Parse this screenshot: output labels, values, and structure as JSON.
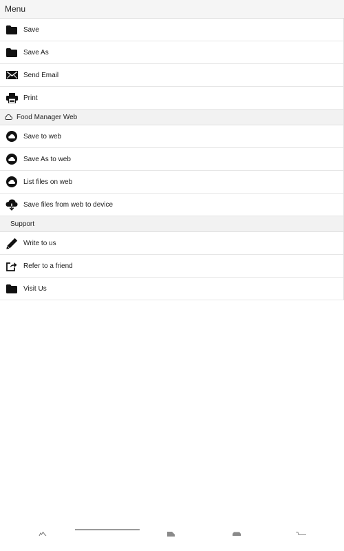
{
  "header": {
    "title": "Menu"
  },
  "main_items": [
    {
      "label": "Save",
      "icon": "folder-icon"
    },
    {
      "label": "Save As",
      "icon": "folder-icon"
    },
    {
      "label": "Send Email",
      "icon": "envelope-icon"
    },
    {
      "label": "Print",
      "icon": "printer-icon"
    }
  ],
  "web_section": {
    "title": "Food Manager Web",
    "icon": "cloud-outline-icon",
    "items": [
      {
        "label": "Save to web",
        "icon": "cloud-circle-icon"
      },
      {
        "label": "Save As to web",
        "icon": "cloud-circle-icon"
      },
      {
        "label": "List files on web",
        "icon": "cloud-circle-icon"
      },
      {
        "label": "Save files from web to device",
        "icon": "cloud-download-icon"
      }
    ]
  },
  "support_section": {
    "title": "Support",
    "items": [
      {
        "label": "Write to us",
        "icon": "pencil-icon"
      },
      {
        "label": "Refer to a friend",
        "icon": "share-icon"
      },
      {
        "label": "Visit Us",
        "icon": "folder-icon"
      }
    ]
  },
  "bottom_tabs": [
    {
      "icon": "tab-home-icon"
    },
    {
      "icon": "tab-document-icon"
    },
    {
      "icon": "tab-shop-icon"
    },
    {
      "icon": "tab-cart-icon"
    }
  ],
  "colors": {
    "header_bg": "#f5f5f5",
    "section_bg": "#f2f2f2",
    "divider": "#e6e6e6",
    "icon": "#111111"
  }
}
